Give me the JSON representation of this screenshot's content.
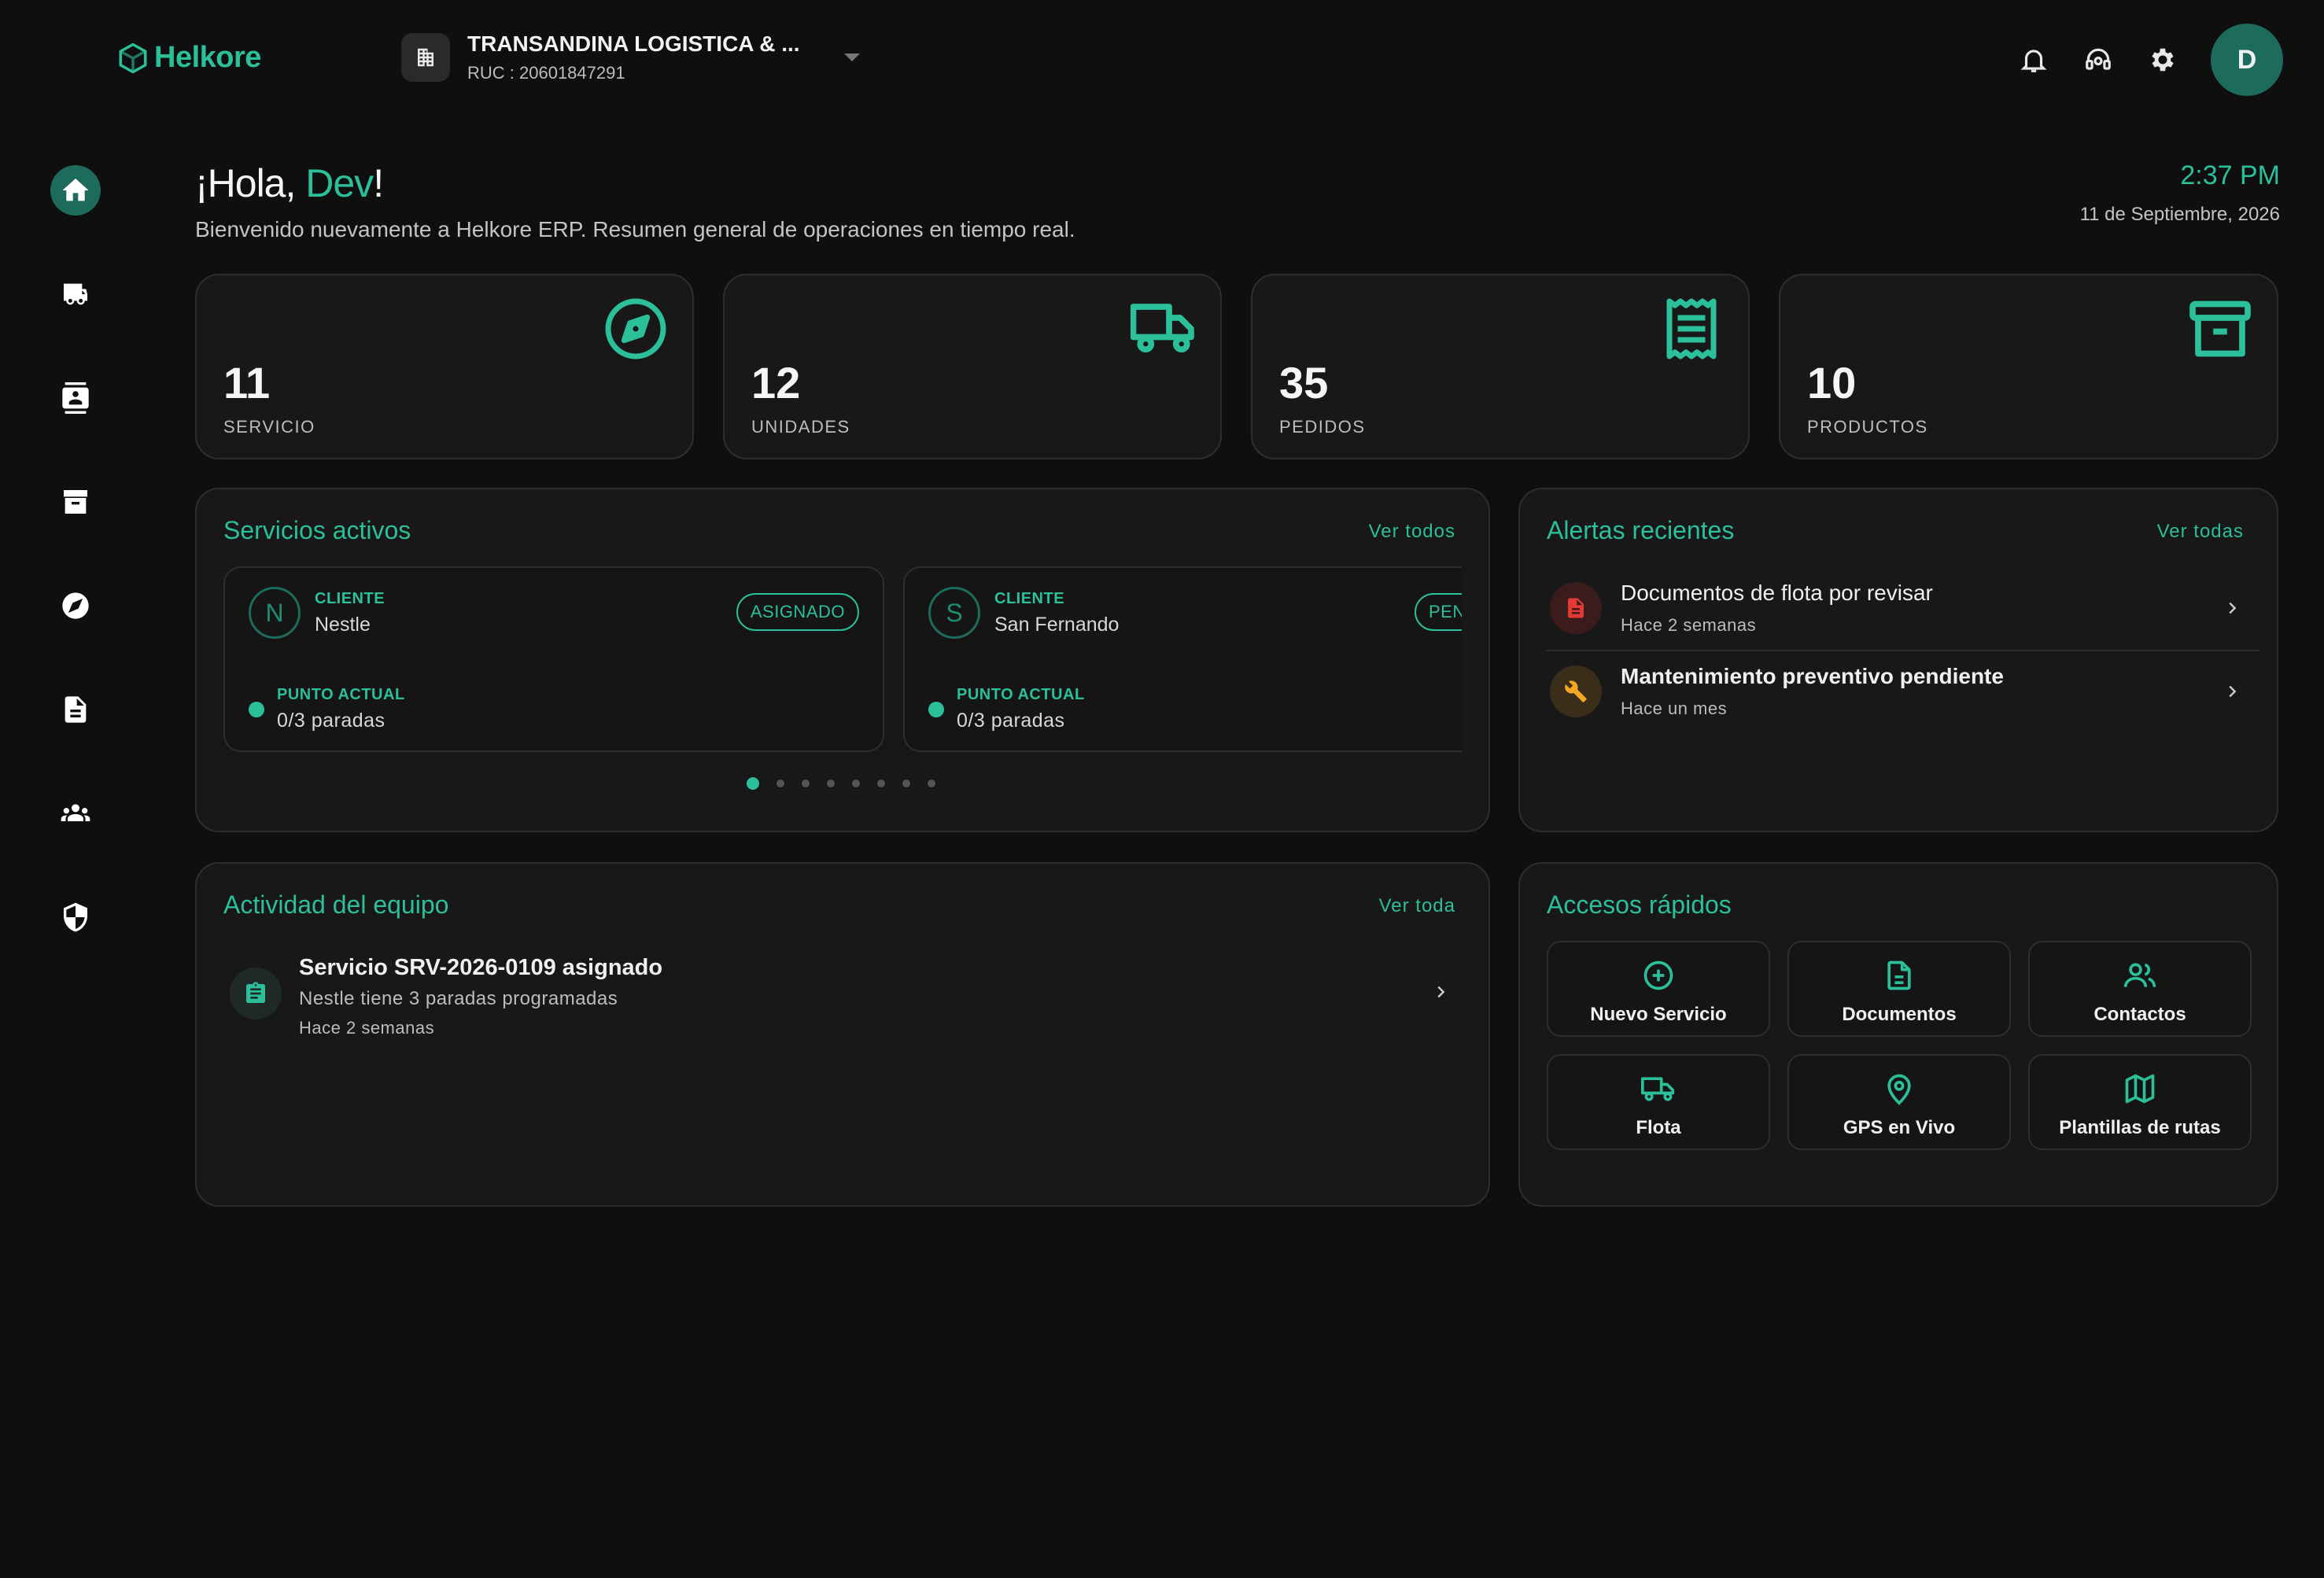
{
  "brand": {
    "name": "Helkore",
    "accent": "#2bbf9a"
  },
  "company": {
    "name": "TRANSANDINA LOGISTICA & ...",
    "ruc": "RUC : 20601847291"
  },
  "user": {
    "initial": "D"
  },
  "sidebar": {
    "items": [
      {
        "icon": "home-icon",
        "active": true
      },
      {
        "icon": "truck-icon"
      },
      {
        "icon": "contacts-icon"
      },
      {
        "icon": "archive-icon"
      },
      {
        "icon": "compass-icon"
      },
      {
        "icon": "document-icon"
      },
      {
        "icon": "team-icon"
      },
      {
        "icon": "security-icon"
      }
    ]
  },
  "greeting": {
    "prefix": "¡Hola, ",
    "name": "Dev",
    "suffix": "!",
    "subtitle": "Bienvenido nuevamente a Helkore ERP. Resumen general de operaciones en tiempo real."
  },
  "clock": {
    "time": "2:37 PM",
    "date": "11 de Septiembre, 2026"
  },
  "stats": [
    {
      "value": "11",
      "label": "SERVICIO",
      "icon": "compass-icon"
    },
    {
      "value": "12",
      "label": "UNIDADES",
      "icon": "truck-icon"
    },
    {
      "value": "35",
      "label": "PEDIDOS",
      "icon": "receipt-icon"
    },
    {
      "value": "10",
      "label": "PRODUCTOS",
      "icon": "archive-icon"
    }
  ],
  "services": {
    "title": "Servicios activos",
    "link": "Ver todos",
    "items": [
      {
        "initial": "N",
        "client_label": "CLIENTE",
        "client": "Nestle",
        "status": "ASIGNADO",
        "point_label": "PUNTO ACTUAL",
        "point": "0/3 paradas"
      },
      {
        "initial": "S",
        "client_label": "CLIENTE",
        "client": "San Fernando",
        "status": "PEN",
        "point_label": "PUNTO ACTUAL",
        "point": "0/3 paradas"
      }
    ],
    "pagination": {
      "total": 8,
      "current": 1
    }
  },
  "alerts": {
    "title": "Alertas recientes",
    "link": "Ver todas",
    "items": [
      {
        "icon": "document-alert-icon",
        "color": "#e53935",
        "bg": "#3a1c1c",
        "title": "Documentos de flota por revisar",
        "time": "Hace 2 semanas"
      },
      {
        "icon": "wrench-icon",
        "color": "#f5a623",
        "bg": "#3a2d1a",
        "title": "Mantenimiento preventivo pendiente",
        "time": "Hace un mes"
      }
    ]
  },
  "activity": {
    "title": "Actividad del equipo",
    "link": "Ver toda",
    "items": [
      {
        "icon": "clipboard-icon",
        "title": "Servicio SRV-2026-0109 asignado",
        "desc": "Nestle tiene 3 paradas programadas",
        "time": "Hace 2 semanas"
      }
    ]
  },
  "quick": {
    "title": "Accesos rápidos",
    "items": [
      {
        "icon": "plus-circle-icon",
        "label": "Nuevo Servicio"
      },
      {
        "icon": "file-icon",
        "label": "Documentos"
      },
      {
        "icon": "users-icon",
        "label": "Contactos"
      },
      {
        "icon": "truck-icon",
        "label": "Flota"
      },
      {
        "icon": "map-pin-icon",
        "label": "GPS en Vivo"
      },
      {
        "icon": "map-icon",
        "label": "Plantillas de rutas"
      }
    ]
  }
}
